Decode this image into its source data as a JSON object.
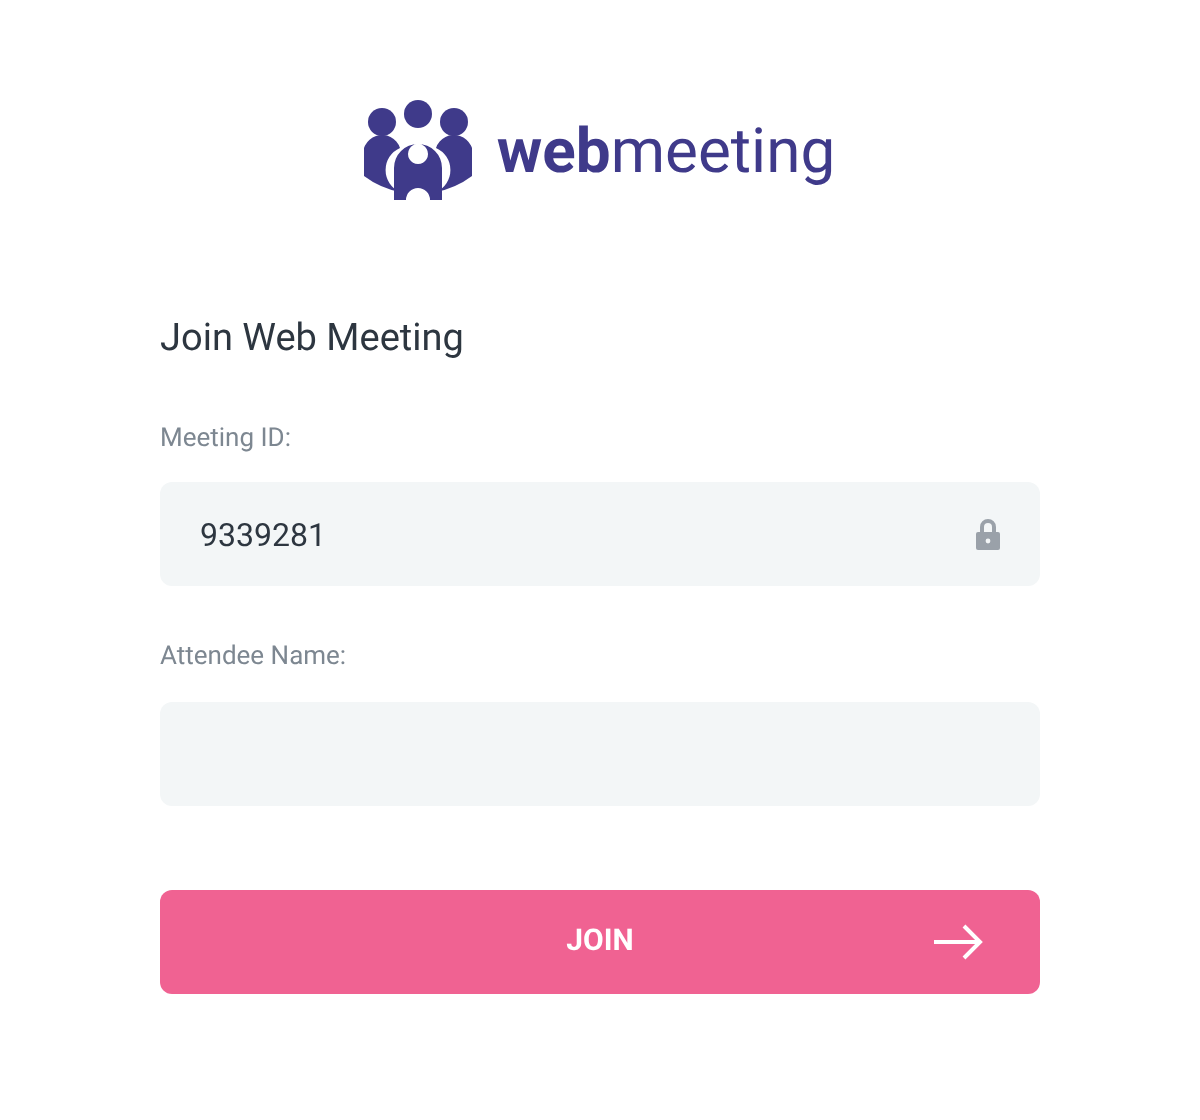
{
  "logo": {
    "text": "**web**meeting"
  },
  "heading": "Join Web Meeting",
  "fields": [
    {
      "label": "Meeting ID:",
      "value": "9339281",
      "locked": true
    },
    {
      "label": "Attendee Name:",
      "locked": false
    }
  ],
  "join_button": {
    "label": "JOIN"
  }
}
